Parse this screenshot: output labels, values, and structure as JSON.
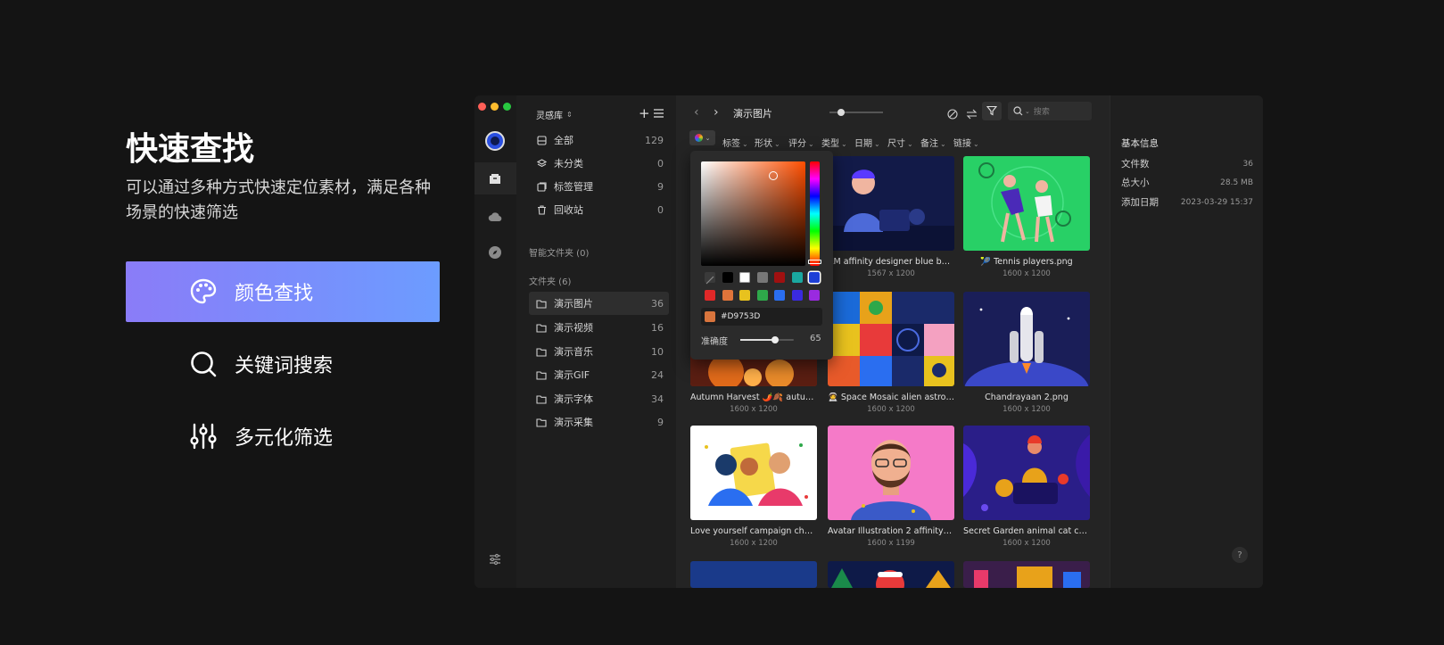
{
  "hero": {
    "title": "快速查找",
    "subtitle": "可以通过多种方式快速定位素材，满足各种场景的快速筛选",
    "features": [
      {
        "label": "颜色查找",
        "icon": "palette-icon",
        "active": true
      },
      {
        "label": "关键词搜索",
        "icon": "search-icon",
        "active": false
      },
      {
        "label": "多元化筛选",
        "icon": "sliders-icon",
        "active": false
      }
    ]
  },
  "sidebar": {
    "library": "灵感库",
    "items": [
      {
        "label": "全部",
        "count": "129"
      },
      {
        "label": "未分类",
        "count": "0"
      },
      {
        "label": "标签管理",
        "count": "9"
      },
      {
        "label": "回收站",
        "count": "0"
      }
    ],
    "smart_folders": "智能文件夹 (0)",
    "folders_header": "文件夹 (6)",
    "folders": [
      {
        "label": "演示图片",
        "count": "36"
      },
      {
        "label": "演示视频",
        "count": "16"
      },
      {
        "label": "演示音乐",
        "count": "10"
      },
      {
        "label": "演示GIF",
        "count": "24"
      },
      {
        "label": "演示字体",
        "count": "34"
      },
      {
        "label": "演示采集",
        "count": "9"
      }
    ]
  },
  "toolbar": {
    "title": "演示图片",
    "search_placeholder": "搜索",
    "filters": [
      "标签",
      "形状",
      "评分",
      "类型",
      "日期",
      "尺寸",
      "备注",
      "链接"
    ]
  },
  "picker": {
    "hex": "#D9753D",
    "accuracy_label": "准确度",
    "accuracy_value": "65",
    "accuracy_fraction": 0.65,
    "selected_color": "#d9753d",
    "row1": [
      "none",
      "#000000",
      "#ffffff",
      "#777777",
      "#a01010",
      "#1aa8a0",
      "#1d3fd6"
    ],
    "row2": [
      "#e02828",
      "#e0743a",
      "#e8c21e",
      "#2ea84a",
      "#2a6ef0",
      "#3a2ae0",
      "#9a2ae0"
    ]
  },
  "grid": [
    {
      "caption": "",
      "size": ""
    },
    {
      "caption": "AM affinity designer blue boy ...",
      "size": "1567 x 1200"
    },
    {
      "caption": "🎾 Tennis players.png",
      "size": "1600 x 1200"
    },
    {
      "caption": "Autumn Harvest 🌶️🍂 autumn be...",
      "size": "1600 x 1200"
    },
    {
      "caption": "🧑‍🚀 Space Mosaic alien astronaut...",
      "size": "1600 x 1200"
    },
    {
      "caption": "Chandrayaan 2.png",
      "size": "1600 x 1200"
    },
    {
      "caption": "Love yourself campaign charact...",
      "size": "1600 x 1200"
    },
    {
      "caption": "Avatar Illustration 2 affinity desi...",
      "size": "1600 x 1199"
    },
    {
      "caption": "Secret Garden animal cat chara...",
      "size": "1600 x 1200"
    }
  ],
  "info": {
    "header": "基本信息",
    "rows": [
      {
        "label": "文件数",
        "value": "36"
      },
      {
        "label": "总大小",
        "value": "28.5 MB"
      },
      {
        "label": "添加日期",
        "value": "2023-03-29 15:37"
      }
    ],
    "help": "?"
  }
}
